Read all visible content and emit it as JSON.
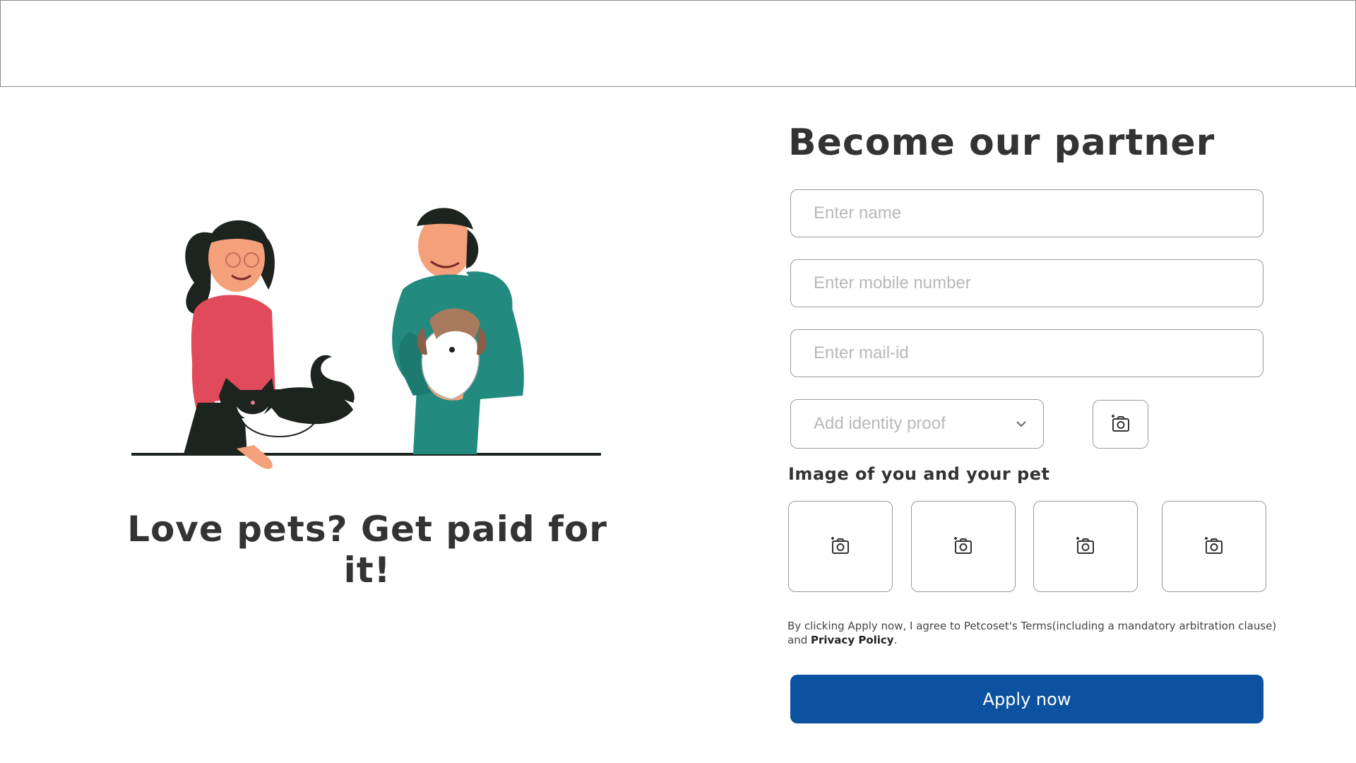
{
  "illustration": {
    "tagline": "Love pets? Get paid for it!"
  },
  "form": {
    "title": "Become our partner",
    "name_placeholder": "Enter name",
    "mobile_placeholder": "Enter mobile number",
    "email_placeholder": "Enter mail-id",
    "identity_select": {
      "selected": "Add identity proof",
      "icon": "chevron-down-icon"
    },
    "identity_upload_icon": "camera-add-icon",
    "pet_images_label": "Image of you and your pet",
    "pet_image_slots": [
      {
        "icon": "camera-add-icon"
      },
      {
        "icon": "camera-add-icon"
      },
      {
        "icon": "camera-add-icon"
      },
      {
        "icon": "camera-add-icon"
      }
    ],
    "terms": {
      "prefix": "By clicking Apply now, I agree to Petcoset's Terms(including a mandatory arbitration clause) and ",
      "link": "Privacy Policy",
      "suffix": "."
    },
    "submit_label": "Apply now"
  },
  "colors": {
    "primary": "#0d52a0",
    "border": "#9a9a9a",
    "placeholder": "#b8b8b8",
    "text": "#333333"
  }
}
